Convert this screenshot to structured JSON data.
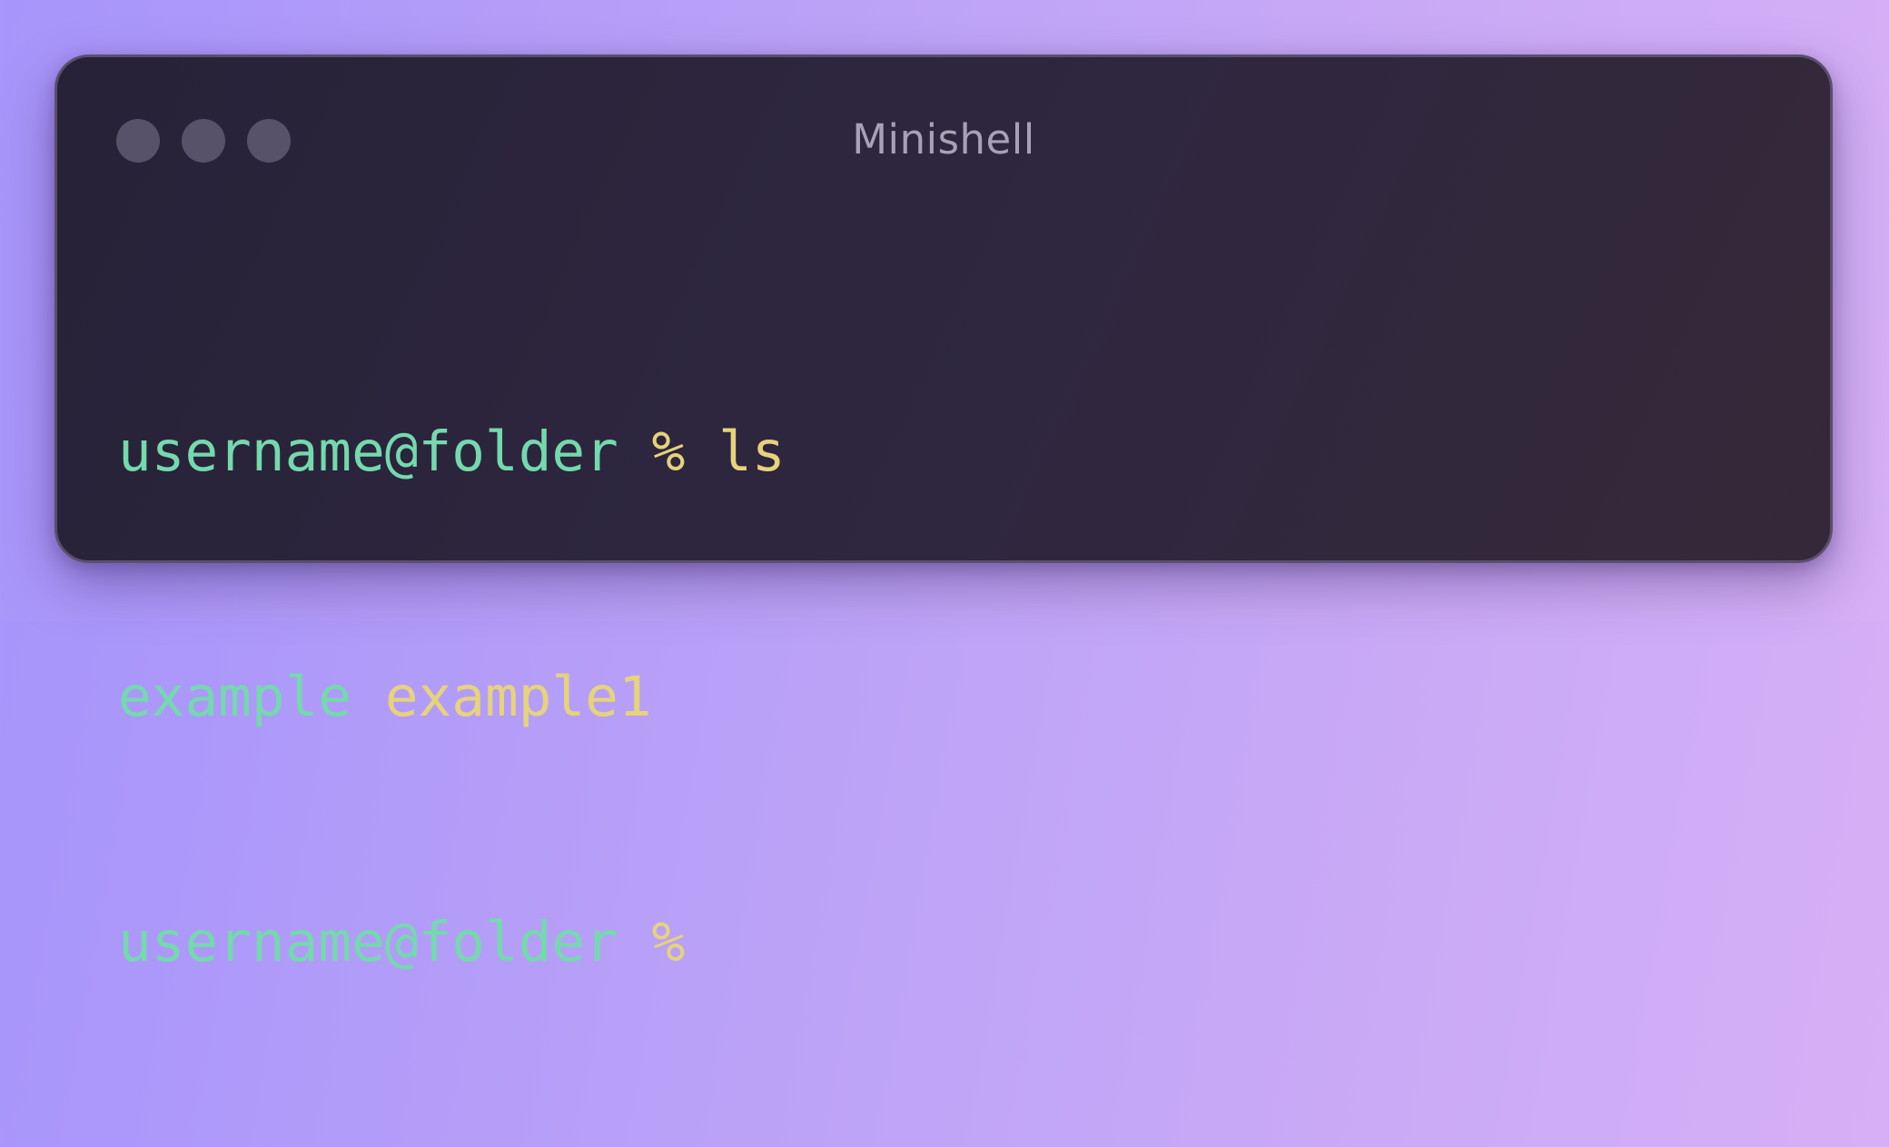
{
  "window": {
    "title": "Minishell",
    "controls": [
      "close",
      "minimize",
      "zoom"
    ]
  },
  "terminal": {
    "lines": [
      {
        "prompt": "username@folder",
        "symbol": "%",
        "command": "ls"
      },
      {
        "output": [
          "example",
          "example1"
        ]
      },
      {
        "prompt": "username@folder",
        "symbol": "%",
        "command": ""
      }
    ]
  },
  "colors": {
    "background_start": "#a795fb",
    "background_end": "#d6b0f6",
    "window_bg": "#2b2439",
    "control_dot": "#58516a",
    "title_text": "#a8a1b6",
    "prompt_green": "#74d9ad",
    "accent_yellow": "#e6d37a"
  }
}
